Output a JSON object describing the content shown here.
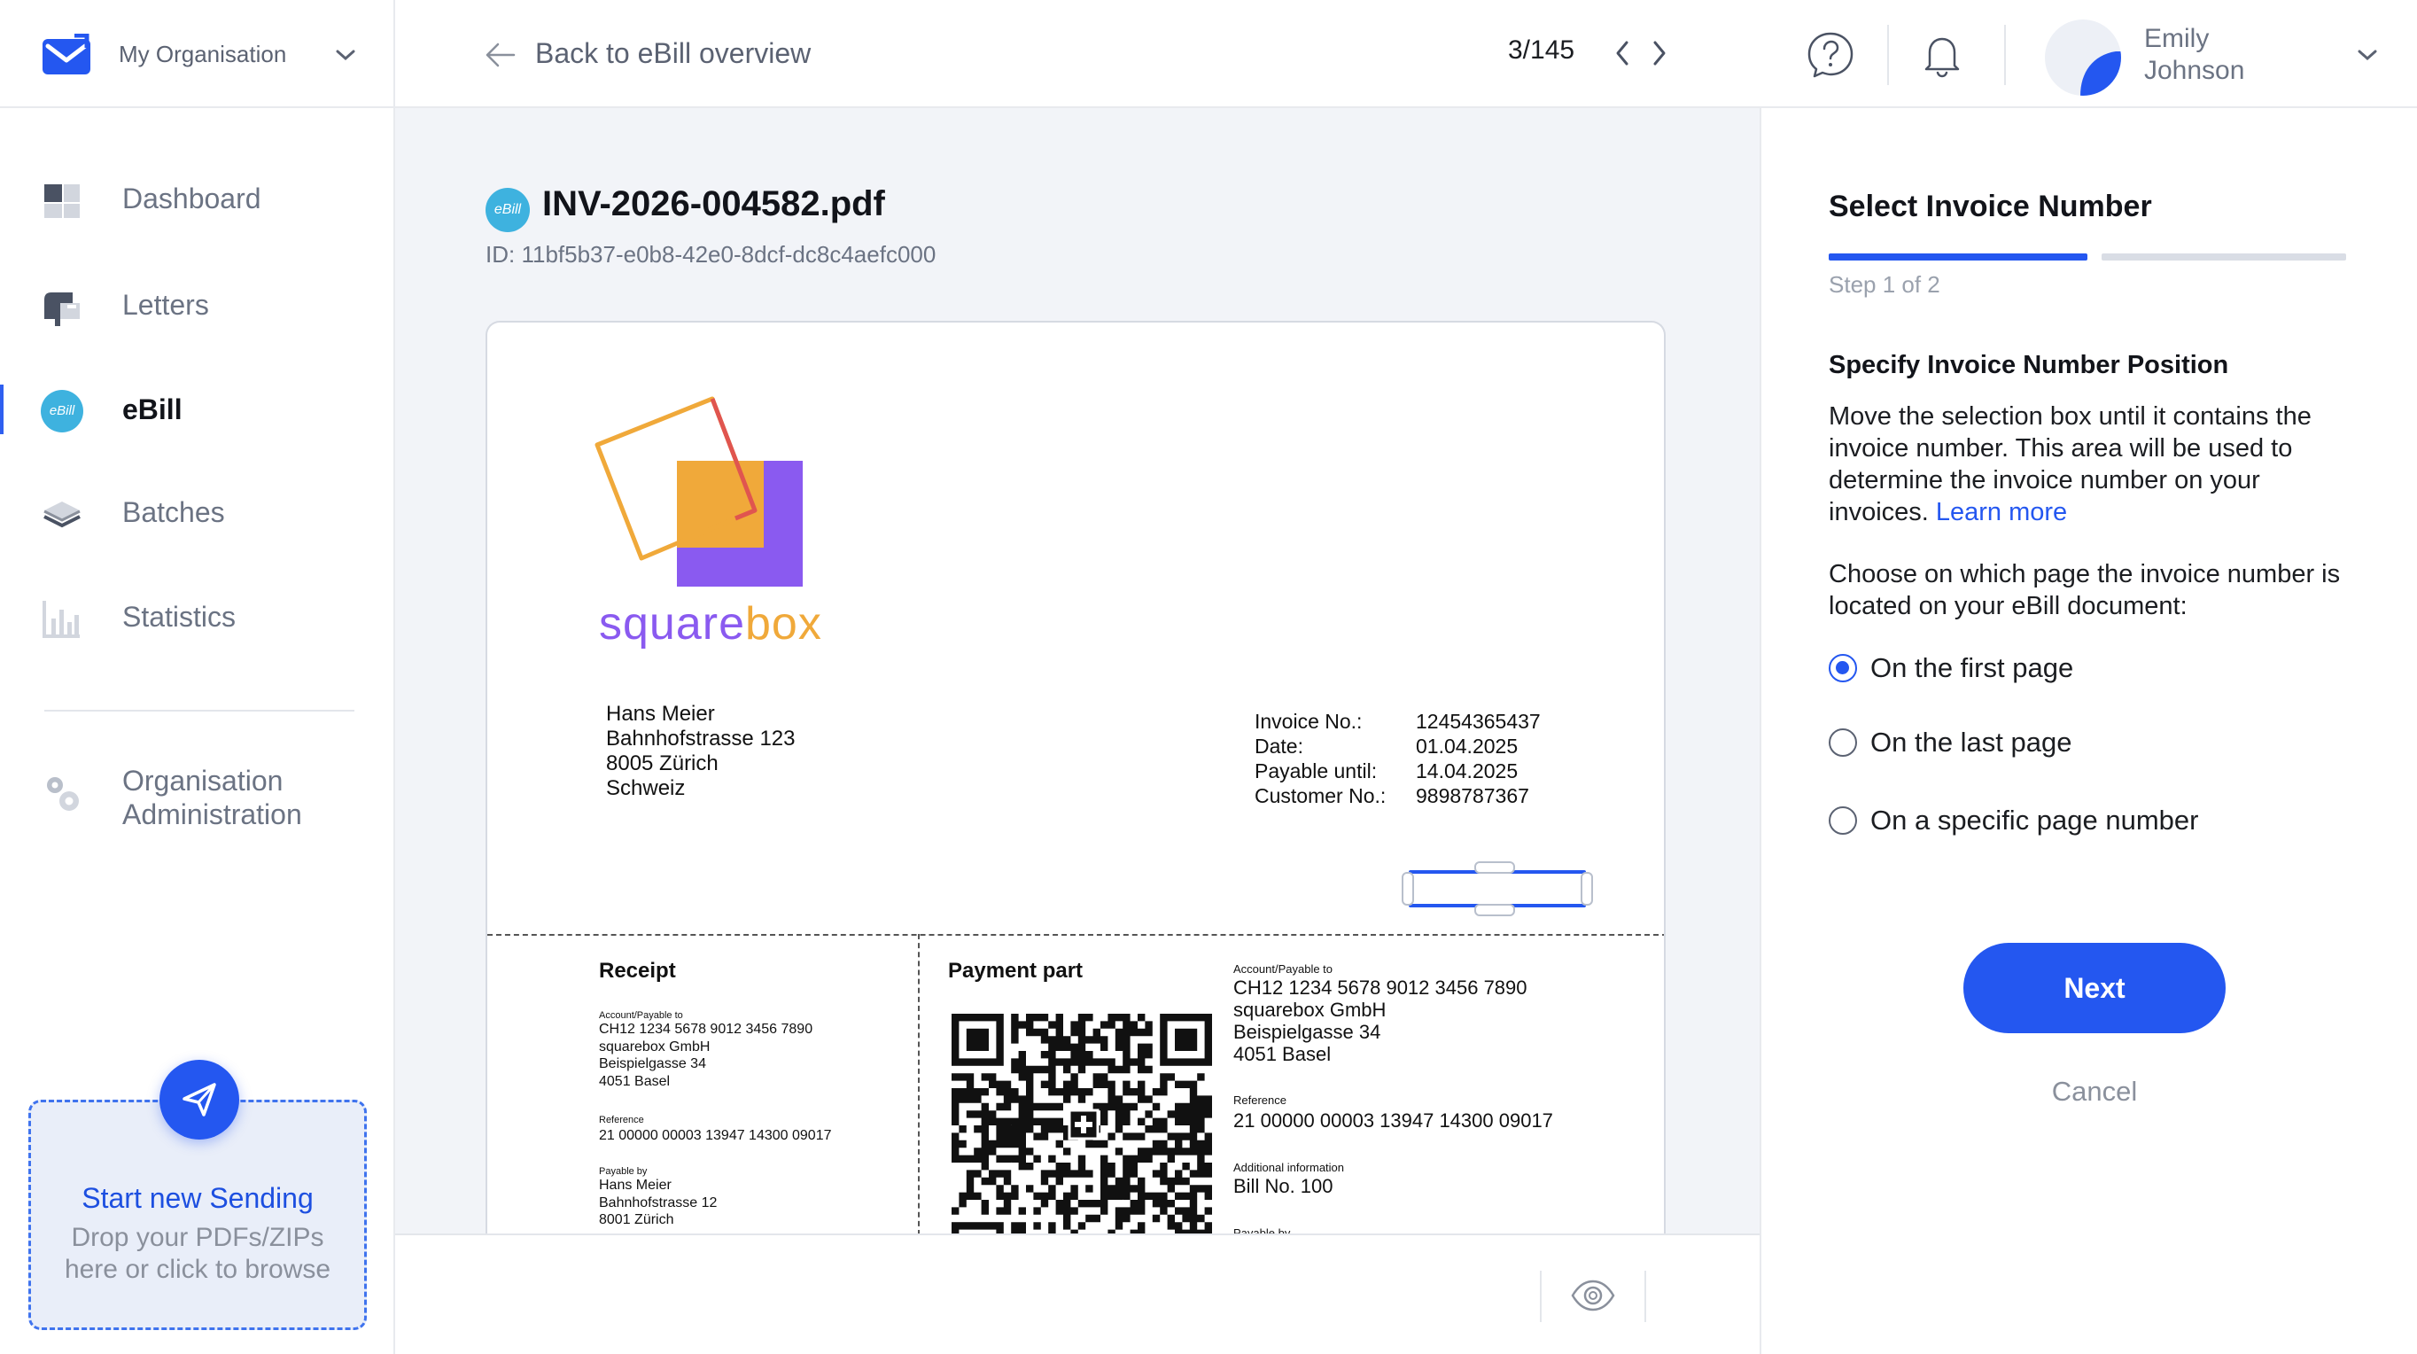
{
  "colors": {
    "accent": "#2457f0",
    "ebill_badge": "#3eb2df",
    "logo_purple": "#8a5af0",
    "logo_orange": "#f0a93a"
  },
  "org": {
    "name": "My Organisation",
    "logo_icon": "envelope-logo-icon",
    "chevron_icon": "chevron-down-icon"
  },
  "sidebar": {
    "items": [
      {
        "label": "Dashboard",
        "icon": "dashboard-icon"
      },
      {
        "label": "Letters",
        "icon": "mailbox-icon"
      },
      {
        "label": "eBill",
        "icon": "ebill-icon",
        "active": true
      },
      {
        "label": "Batches",
        "icon": "layers-icon"
      },
      {
        "label": "Statistics",
        "icon": "bar-chart-icon"
      },
      {
        "label": "Organisation Administration",
        "icon": "gears-icon"
      }
    ],
    "ebill_badge": "eBill",
    "dropzone": {
      "title": "Start new Sending",
      "hint": "Drop your PDFs/ZIPs here or click to browse",
      "icon": "paper-plane-icon"
    }
  },
  "topbar": {
    "back_label": "Back to eBill overview",
    "pager": "3/145",
    "help_icon": "help-icon",
    "bell_icon": "bell-icon",
    "user": {
      "name": "Emily Johnson"
    }
  },
  "document": {
    "badge": "eBill",
    "filename": "INV-2026-004582.pdf",
    "id_line": "ID: 11bf5b37-e0b8-42e0-8dcf-dc8c4aefc000",
    "logo": {
      "word_part1": "square",
      "word_part2": "box"
    },
    "recipient": [
      "Hans Meier",
      "Bahnhofstrasse 123",
      "8005 Zürich",
      "Schweiz"
    ],
    "meta": [
      {
        "k": "Invoice No.:",
        "v": "12454365437"
      },
      {
        "k": "Date:",
        "v": "01.04.2025"
      },
      {
        "k": "Payable until:",
        "v": "14.04.2025"
      },
      {
        "k": "Customer No.:",
        "v": "9898787367"
      }
    ],
    "receipt": {
      "title": "Receipt",
      "account_label": "Account/Payable to",
      "account_lines": [
        "CH12 1234 5678 9012 3456 7890",
        "squarebox GmbH",
        "Beispielgasse 34",
        "4051 Basel"
      ],
      "reference_label": "Reference",
      "reference": "21 00000 00003 13947 14300 09017",
      "payable_by_label": "Payable by",
      "payable_by_lines": [
        "Hans Meier",
        "Bahnhofstrasse 12",
        "8001 Zürich"
      ]
    },
    "payment": {
      "title": "Payment part",
      "account_label": "Account/Payable to",
      "account_lines": [
        "CH12 1234 5678 9012 3456 7890",
        "squarebox GmbH",
        "Beispielgasse 34",
        "4051 Basel"
      ],
      "reference_label": "Reference",
      "reference": "21 00000 00003 13947 14300 09017",
      "additional_label": "Additional information",
      "additional": "Bill No. 100",
      "payable_by_label": "Payable by"
    },
    "footer_icon": "eye-icon"
  },
  "panel": {
    "title": "Select Invoice Number",
    "step_label": "Step 1 of 2",
    "section_heading": "Specify Invoice Number Position",
    "instructions": "Move the selection box until it contains the invoice number. This area will be used to determine the invoice number on your invoices.",
    "learn_more": "Learn more",
    "choose_text": "Choose on which page the invoice number is located on your eBill document:",
    "options": [
      {
        "label": "On the first page",
        "checked": true
      },
      {
        "label": "On the last page",
        "checked": false
      },
      {
        "label": "On a specific page number",
        "checked": false
      }
    ],
    "next_label": "Next",
    "cancel_label": "Cancel"
  }
}
